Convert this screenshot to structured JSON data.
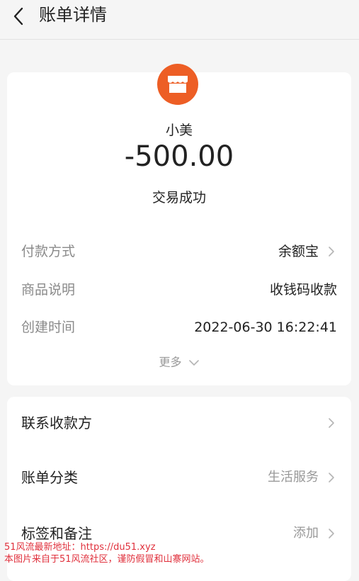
{
  "header": {
    "title": "账单详情"
  },
  "merchant": {
    "name": "小美",
    "amount": "-500.00",
    "status": "交易成功"
  },
  "details": [
    {
      "label": "付款方式",
      "value": "余额宝"
    },
    {
      "label": "商品说明",
      "value": "收钱码收款"
    },
    {
      "label": "创建时间",
      "value": "2022-06-30 16:22:41"
    }
  ],
  "more_label": "更多",
  "actions": [
    {
      "label": "联系收款方",
      "value": ""
    },
    {
      "label": "账单分类",
      "value": "生活服务"
    },
    {
      "label": "标签和备注",
      "value": "添加"
    }
  ],
  "watermark": {
    "line1": "51风流最新地址：https://du51.xyz",
    "line2": "本图片来自于51风流社区，谨防假冒和山寨网站。"
  },
  "colors": {
    "merchant_logo": "#ed5e25",
    "watermark": "#e0303c"
  }
}
